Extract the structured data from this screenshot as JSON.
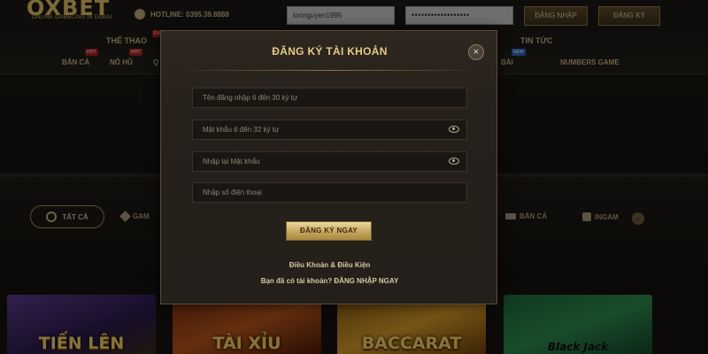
{
  "header": {
    "logo_text": "OXBET",
    "logo_subtitle": "ONLINE GAMBLING IN DUBAI",
    "hotline": "HOTLINE: 0395.39.8888",
    "username_value": "tonnguyen1995",
    "password_value": "••••••••••••••••••",
    "login_label": "ĐĂNG NHẬP",
    "register_label": "ĐĂNG KÝ"
  },
  "nav_primary": {
    "items": [
      {
        "label": "THỂ THAO",
        "badge": "EVENT"
      },
      {
        "label": "TIN TỨC"
      }
    ]
  },
  "nav_secondary": {
    "items": [
      {
        "label": "BẮN CÁ",
        "badge": "HOT"
      },
      {
        "label": "NỔ HŨ",
        "badge": "HOT"
      },
      {
        "label": "Q"
      },
      {
        "label": "BÀI",
        "badge": "NEW"
      },
      {
        "label": "NUMBERS GAME"
      }
    ]
  },
  "categories": {
    "active": "TẤT CẢ",
    "items": [
      "GAM",
      "BẮN CÁ",
      "INGAM"
    ],
    "scroll_arrow": "›"
  },
  "games": [
    {
      "title": "TIẾN LÊN"
    },
    {
      "title": "TÀI XỈU"
    },
    {
      "title": "BACCARAT"
    },
    {
      "title": "Black Jack"
    }
  ],
  "modal": {
    "title": "ĐĂNG KÝ TÀI KHOẢN",
    "close": "×",
    "username_placeholder": "Tên đăng nhập 6 đến 30 ký tự",
    "password_placeholder": "Mật khẩu 6 đến 32 ký tự",
    "confirm_placeholder": "Nhập lại Mật khẩu",
    "phone_placeholder": "Nhập số điện thoại",
    "submit_label": "ĐĂNG KÝ NGAY",
    "terms": "Điều Khoản & Điều Kiện",
    "have_account": "Bạn đã có tài khoản? ĐĂNG NHẬP NGAY"
  },
  "colors": {
    "accent_gold": "#e5c988",
    "background": "#161310",
    "modal_bg": "#2d271f"
  },
  "icons": [
    "phone-icon",
    "eye-icon",
    "close-icon",
    "ring-icon",
    "diamond-icon",
    "gun-icon",
    "dice-icon",
    "chevron-right-icon"
  ]
}
